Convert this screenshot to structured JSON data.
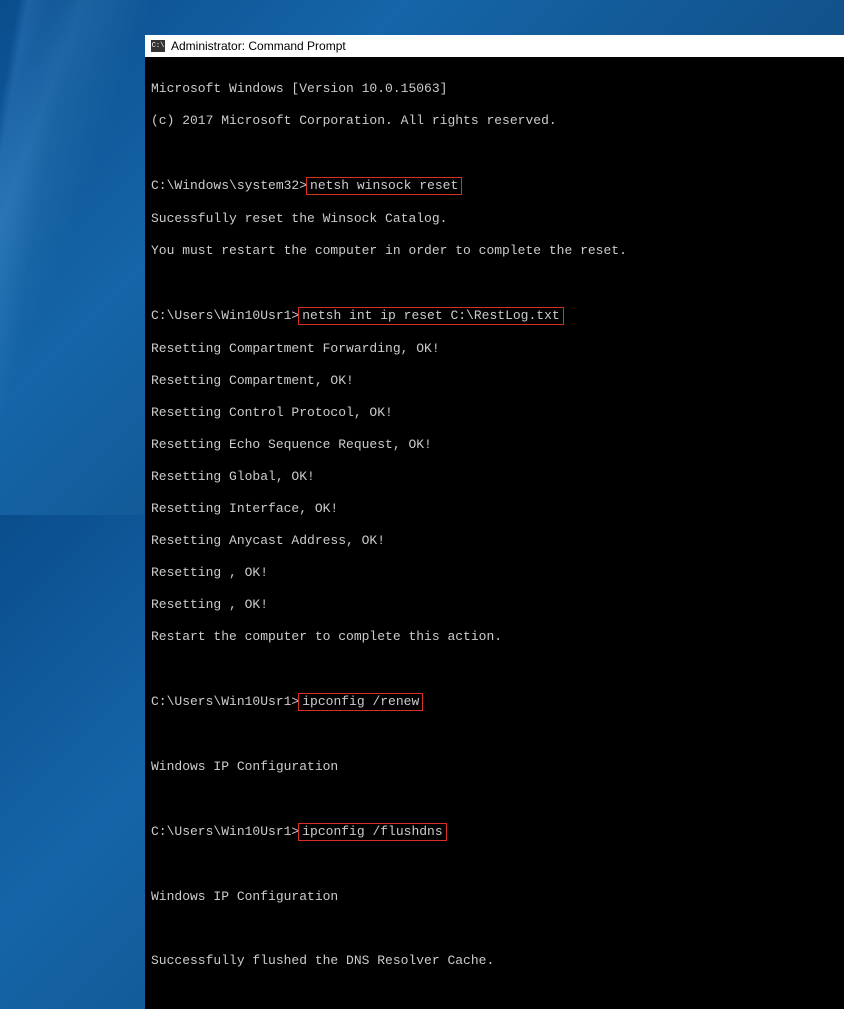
{
  "window": {
    "title": "Administrator: Command Prompt",
    "icon_text": "C:\\"
  },
  "terminal": {
    "header1": "Microsoft Windows [Version 10.0.15063]",
    "header2": "(c) 2017 Microsoft Corporation. All rights reserved.",
    "prompt1_path": "C:\\Windows\\system32>",
    "cmd1": "netsh winsock reset",
    "out1_1": "Sucessfully reset the Winsock Catalog.",
    "out1_2": "You must restart the computer in order to complete the reset.",
    "prompt2_path": "C:\\Users\\Win10Usr1>",
    "cmd2": "netsh int ip reset C:\\RestLog.txt",
    "out2_1": "Resetting Compartment Forwarding, OK!",
    "out2_2": "Resetting Compartment, OK!",
    "out2_3": "Resetting Control Protocol, OK!",
    "out2_4": "Resetting Echo Sequence Request, OK!",
    "out2_5": "Resetting Global, OK!",
    "out2_6": "Resetting Interface, OK!",
    "out2_7": "Resetting Anycast Address, OK!",
    "out2_8": "Resetting , OK!",
    "out2_9": "Resetting , OK!",
    "out2_10": "Restart the computer to complete this action.",
    "prompt3_path": "C:\\Users\\Win10Usr1>",
    "cmd3": "ipconfig /renew",
    "out3_1": "Windows IP Configuration",
    "prompt4_path": "C:\\Users\\Win10Usr1>",
    "cmd4": "ipconfig /flushdns",
    "out4_1": "Windows IP Configuration",
    "out4_2": "Successfully flushed the DNS Resolver Cache."
  }
}
